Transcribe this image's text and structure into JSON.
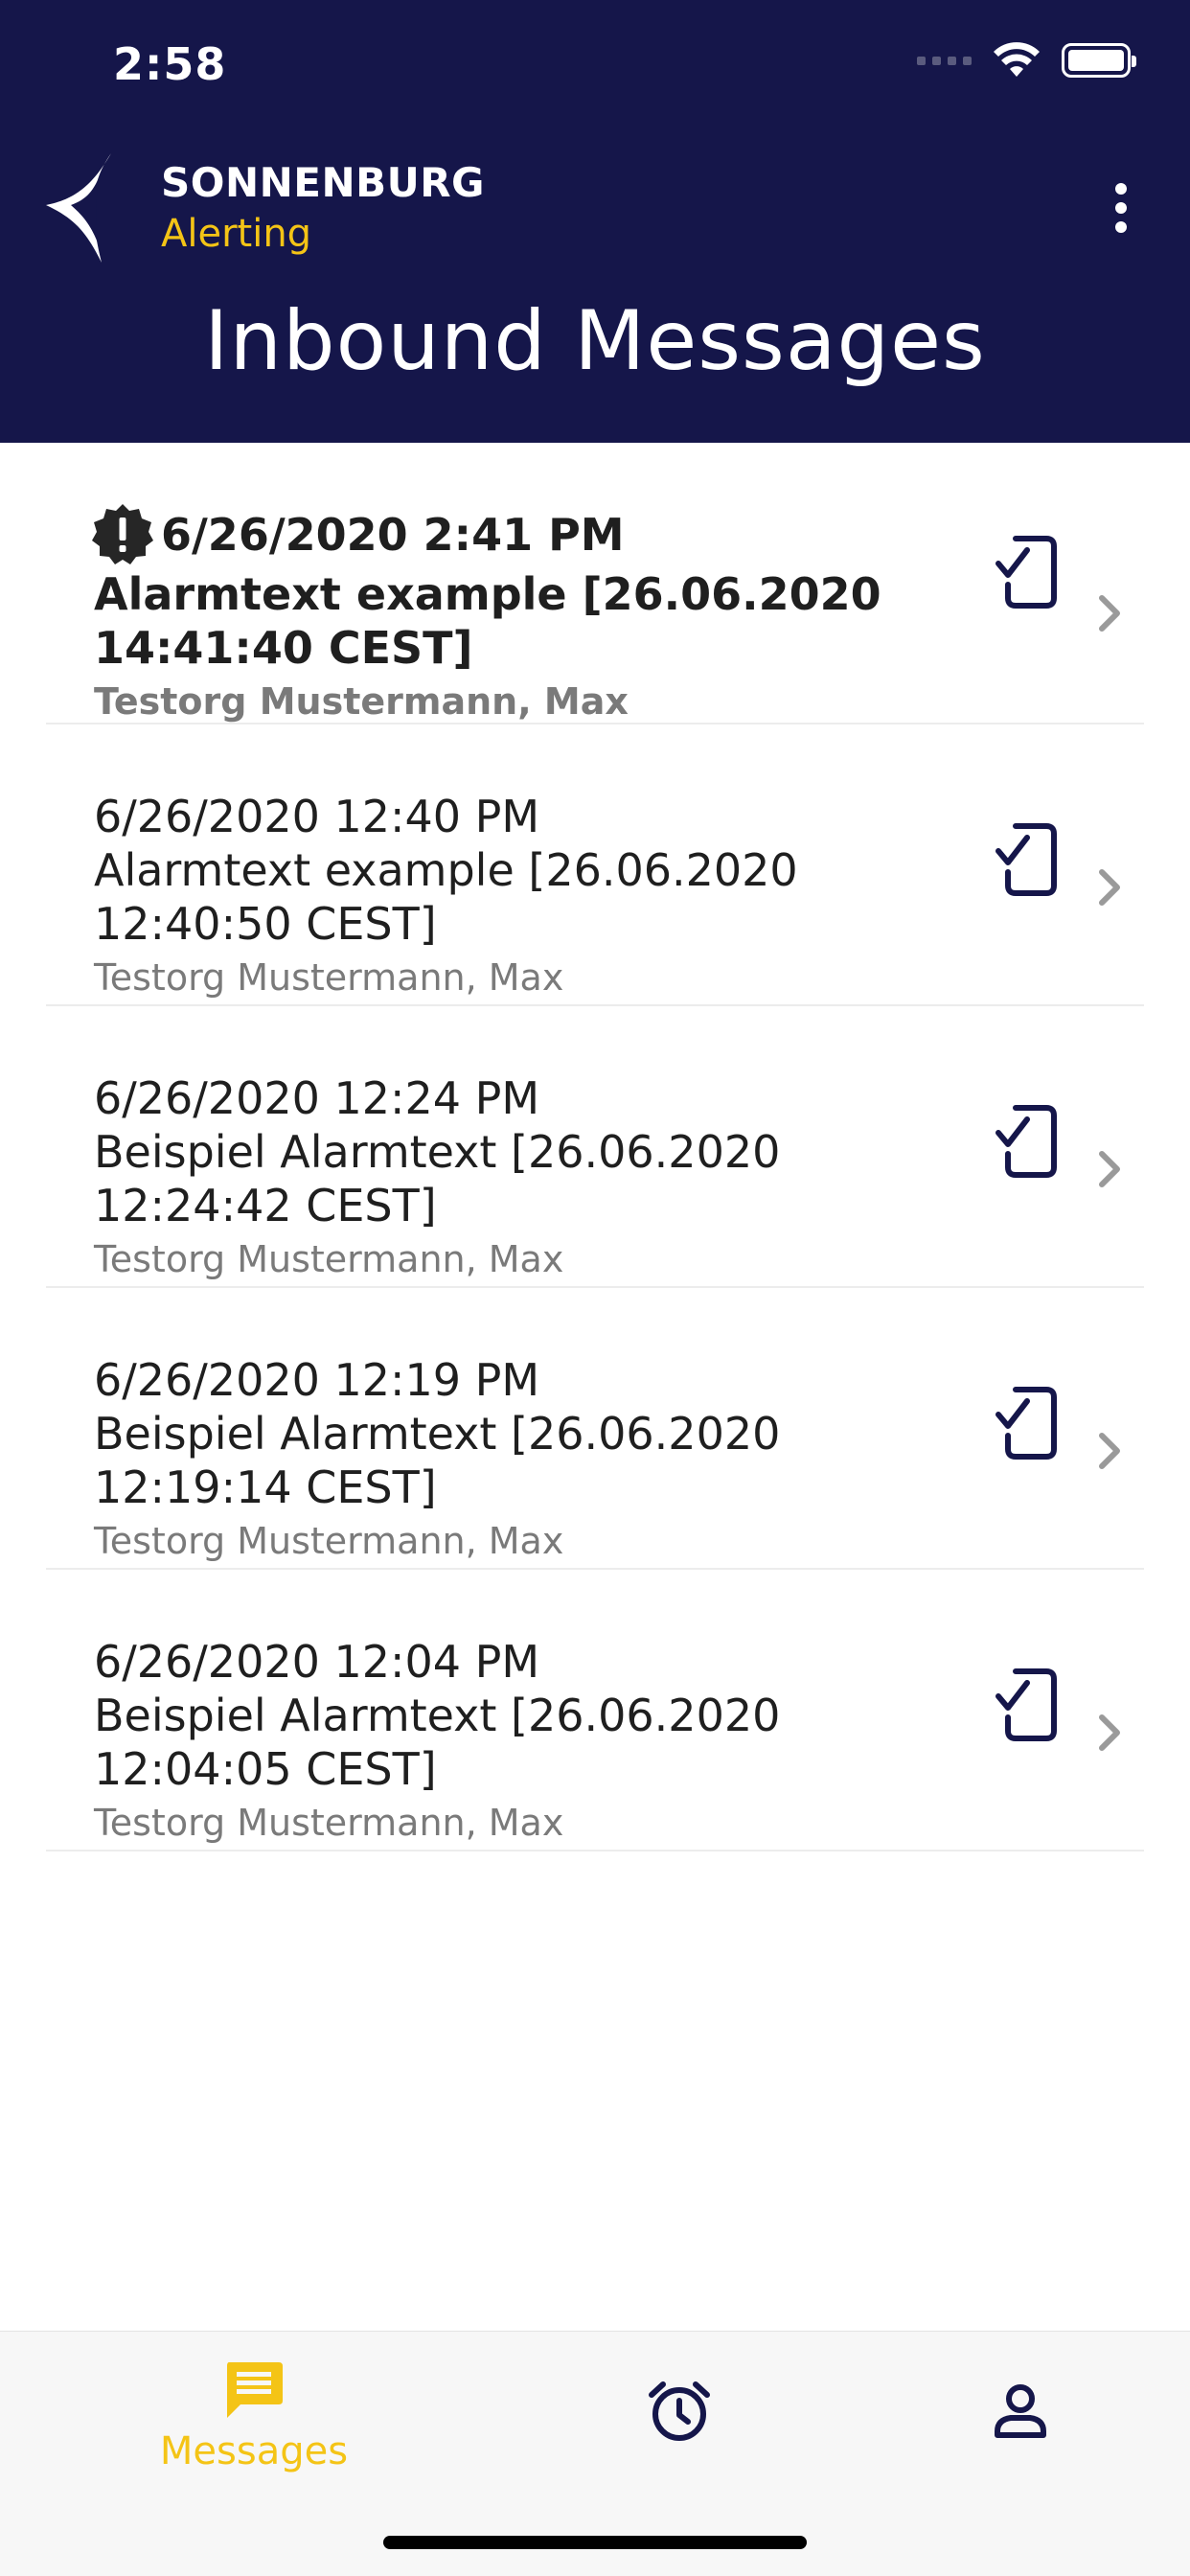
{
  "status_bar": {
    "time": "2:58"
  },
  "header": {
    "brand_name": "SONNENBURG",
    "brand_sub": "Alerting",
    "title": "Inbound Messages",
    "more_icon": "more-vertical-icon"
  },
  "messages": [
    {
      "date": "6/26/2020 2:41 PM",
      "title_line1": "Alarmtext example [26.06.2020",
      "title_line2": "14:41:40 CEST]",
      "sender": "Testorg Mustermann, Max",
      "unread": true,
      "priority_icon": "alert-badge-icon",
      "status_icon": "phone-check-icon"
    },
    {
      "date": "6/26/2020 12:40 PM",
      "title_line1": "Alarmtext example [26.06.2020",
      "title_line2": "12:40:50 CEST]",
      "sender": "Testorg Mustermann, Max",
      "unread": false,
      "status_icon": "phone-check-icon"
    },
    {
      "date": "6/26/2020 12:24 PM",
      "title_line1": "Beispiel Alarmtext [26.06.2020",
      "title_line2": "12:24:42 CEST]",
      "sender": "Testorg Mustermann, Max",
      "unread": false,
      "status_icon": "phone-check-icon"
    },
    {
      "date": "6/26/2020 12:19 PM",
      "title_line1": "Beispiel Alarmtext [26.06.2020",
      "title_line2": "12:19:14 CEST]",
      "sender": "Testorg Mustermann, Max",
      "unread": false,
      "status_icon": "phone-check-icon"
    },
    {
      "date": "6/26/2020 12:04 PM",
      "title_line1": "Beispiel Alarmtext [26.06.2020",
      "title_line2": "12:04:05 CEST]",
      "sender": "Testorg Mustermann, Max",
      "unread": false,
      "status_icon": "phone-check-icon"
    }
  ],
  "tabbar": {
    "tabs": [
      {
        "label": "Messages",
        "icon": "message-icon",
        "active": true
      },
      {
        "label": "",
        "icon": "alarm-clock-icon",
        "active": false
      },
      {
        "label": "",
        "icon": "profile-icon",
        "active": false
      }
    ]
  },
  "colors": {
    "header_bg": "#15164a",
    "accent": "#f4c416",
    "icon_dark": "#15164a",
    "secondary_text": "#7a7a7a"
  }
}
